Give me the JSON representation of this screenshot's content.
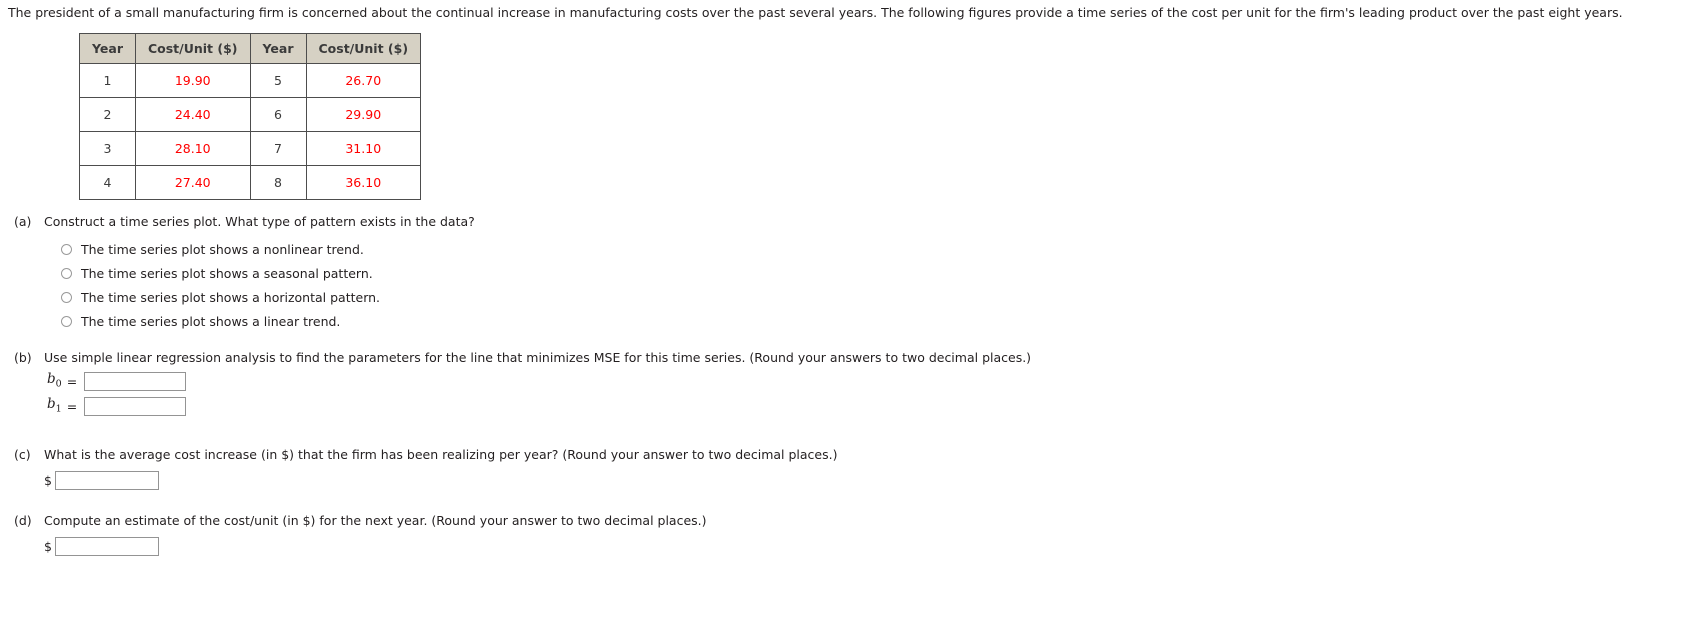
{
  "intro": "The president of a small manufacturing firm is concerned about the continual increase in manufacturing costs over the past several years. The following figures provide a time series of the cost per unit for the firm's leading product over the past eight years.",
  "table": {
    "headers": [
      "Year",
      "Cost/Unit ($)",
      "Year",
      "Cost/Unit ($)"
    ],
    "rows": [
      [
        "1",
        "19.90",
        "5",
        "26.70"
      ],
      [
        "2",
        "24.40",
        "6",
        "29.90"
      ],
      [
        "3",
        "28.10",
        "7",
        "31.10"
      ],
      [
        "4",
        "27.40",
        "8",
        "36.10"
      ]
    ]
  },
  "chart_data": {
    "type": "table",
    "title": "Cost per unit over eight years",
    "xlabel": "Year",
    "ylabel": "Cost/Unit ($)",
    "x": [
      1,
      2,
      3,
      4,
      5,
      6,
      7,
      8
    ],
    "values": [
      19.9,
      24.4,
      28.1,
      27.4,
      26.7,
      29.9,
      31.1,
      36.1
    ],
    "categories": [
      "1",
      "2",
      "3",
      "4",
      "5",
      "6",
      "7",
      "8"
    ]
  },
  "parts": {
    "a": {
      "label": "(a)",
      "text": "Construct a time series plot. What type of pattern exists in the data?",
      "options": [
        "The time series plot shows a nonlinear trend.",
        "The time series plot shows a seasonal pattern.",
        "The time series plot shows a horizontal pattern.",
        "The time series plot shows a linear trend."
      ]
    },
    "b": {
      "label": "(b)",
      "text": "Use simple linear regression analysis to find the parameters for the line that minimizes MSE for this time series. (Round your answers to two decimal places.)",
      "b0_label": "b",
      "b0_sub": "0",
      "b1_label": "b",
      "b1_sub": "1",
      "equals": "=",
      "b0_value": "",
      "b1_value": "",
      "placeholder": ""
    },
    "c": {
      "label": "(c)",
      "text": "What is the average cost increase (in $) that the firm has been realizing per year? (Round your answer to two decimal places.)",
      "currency": "$",
      "value": "",
      "placeholder": ""
    },
    "d": {
      "label": "(d)",
      "text": "Compute an estimate of the cost/unit (in $) for the next year. (Round your answer to two decimal places.)",
      "currency": "$",
      "value": "",
      "placeholder": ""
    }
  },
  "colors": {
    "header_bg": "#d6d1c4",
    "data_value": "#ff0000",
    "border": "#4d4d4d",
    "text": "#231f20"
  }
}
